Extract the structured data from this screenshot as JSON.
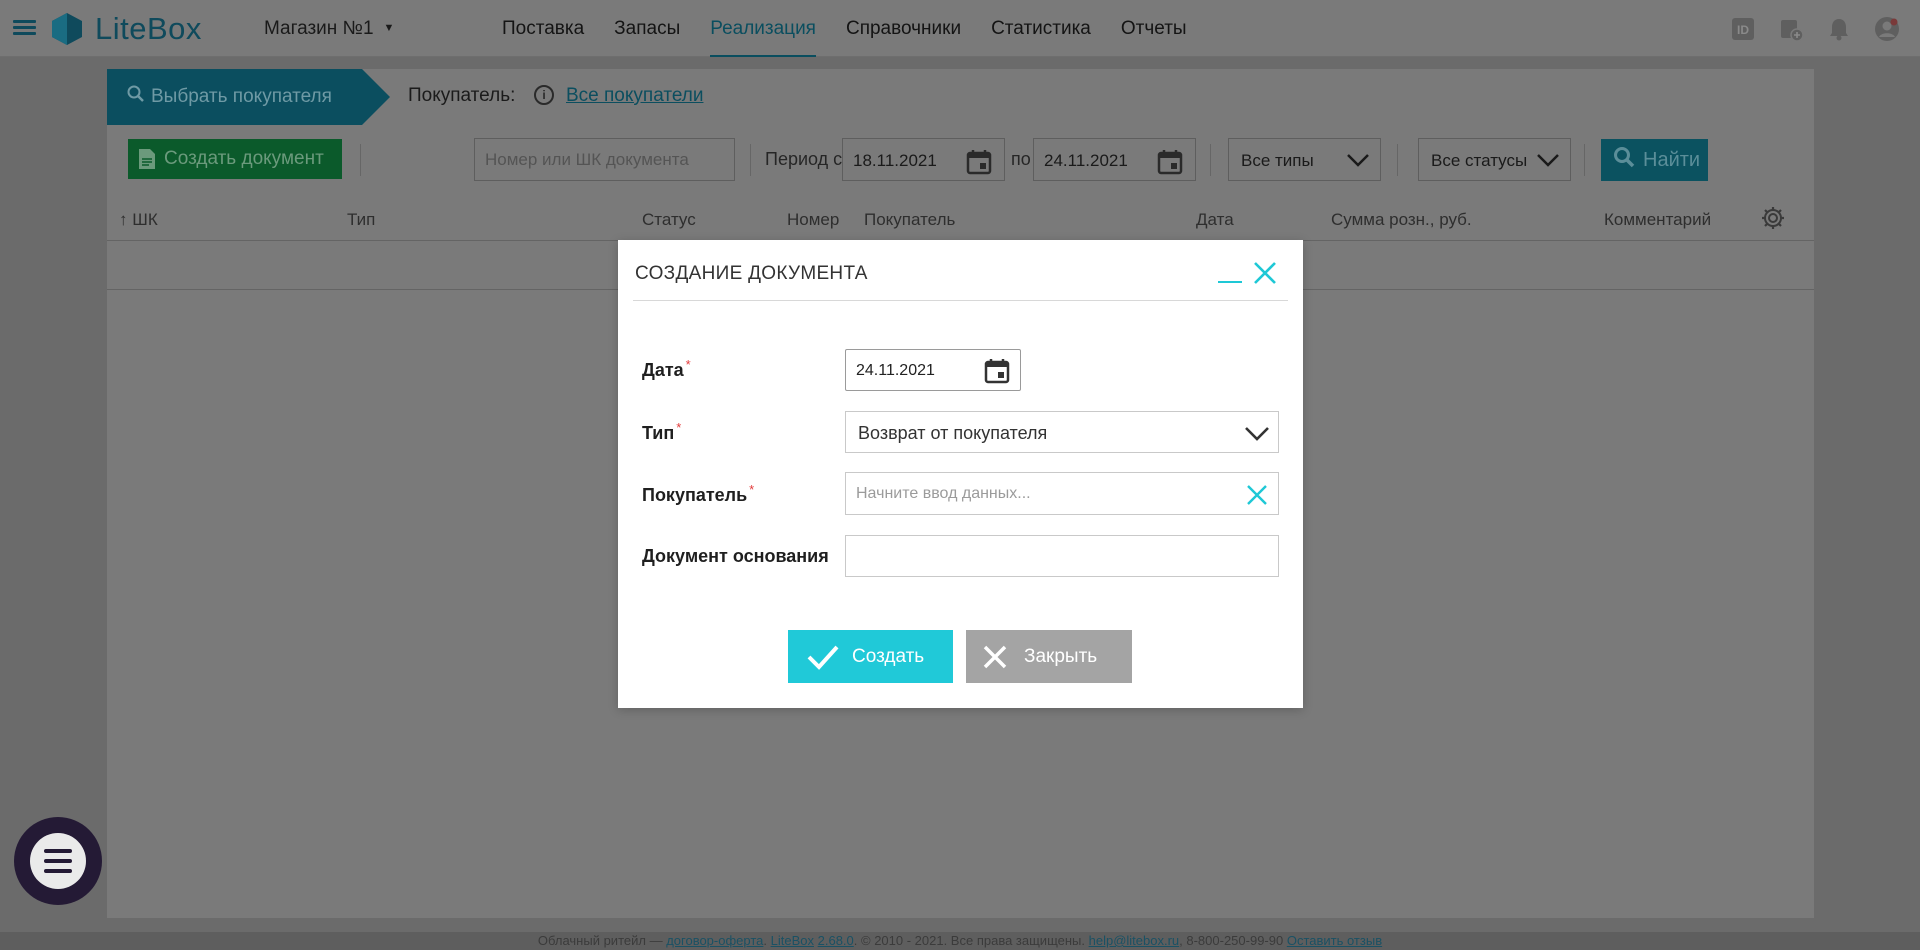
{
  "app": {
    "logo_text": "LiteBox",
    "store_name": "Магазин №1"
  },
  "nav": [
    {
      "label": "Поставка"
    },
    {
      "label": "Запасы"
    },
    {
      "label": "Реализация",
      "active": true
    },
    {
      "label": "Справочники"
    },
    {
      "label": "Статистика"
    },
    {
      "label": "Отчеты"
    }
  ],
  "toolbar": {
    "select_buyer": "Выбрать покупателя",
    "buyer_label": "Покупатель:",
    "all_buyers": "Все покупатели",
    "create_doc": "Создать документ",
    "doc_search_placeholder": "Номер или ШК документа",
    "period_label": "Период с",
    "date_from": "18.11.2021",
    "po": "по",
    "date_to": "24.11.2021",
    "types": "Все типы",
    "statuses": "Все статусы",
    "find": "Найти"
  },
  "table": {
    "columns": [
      "ШК",
      "Тип",
      "Статус",
      "Номер",
      "Покупатель",
      "Дата",
      "Сумма розн., руб.",
      "Комментарий"
    ]
  },
  "modal": {
    "title": "СОЗДАНИЕ ДОКУМЕНТА",
    "date_label": "Дата",
    "date_value": "24.11.2021",
    "type_label": "Тип",
    "type_value": "Возврат от покупателя",
    "buyer_label": "Покупатель",
    "buyer_placeholder": "Начните ввод данных...",
    "base_doc_label": "Документ основания",
    "required_mark": "*",
    "create_button": "Создать",
    "close_button": "Закрыть"
  },
  "footer": {
    "text1": "Облачный ритейл — ",
    "link1": "договор-оферта",
    "text2": ". ",
    "link2": "LiteBox",
    "text3": " ",
    "link3": "2.68.0",
    "text4": ". © 2010 - 2021. Все права защищены. ",
    "link4": "help@litebox.ru",
    "text5": ", 8-800-250-99-90 ",
    "link5": "Оставить отзыв"
  },
  "colors": {
    "accent": "#20c9d8",
    "brand_dark": "#0b4e5f",
    "required": "#e23a3a"
  }
}
